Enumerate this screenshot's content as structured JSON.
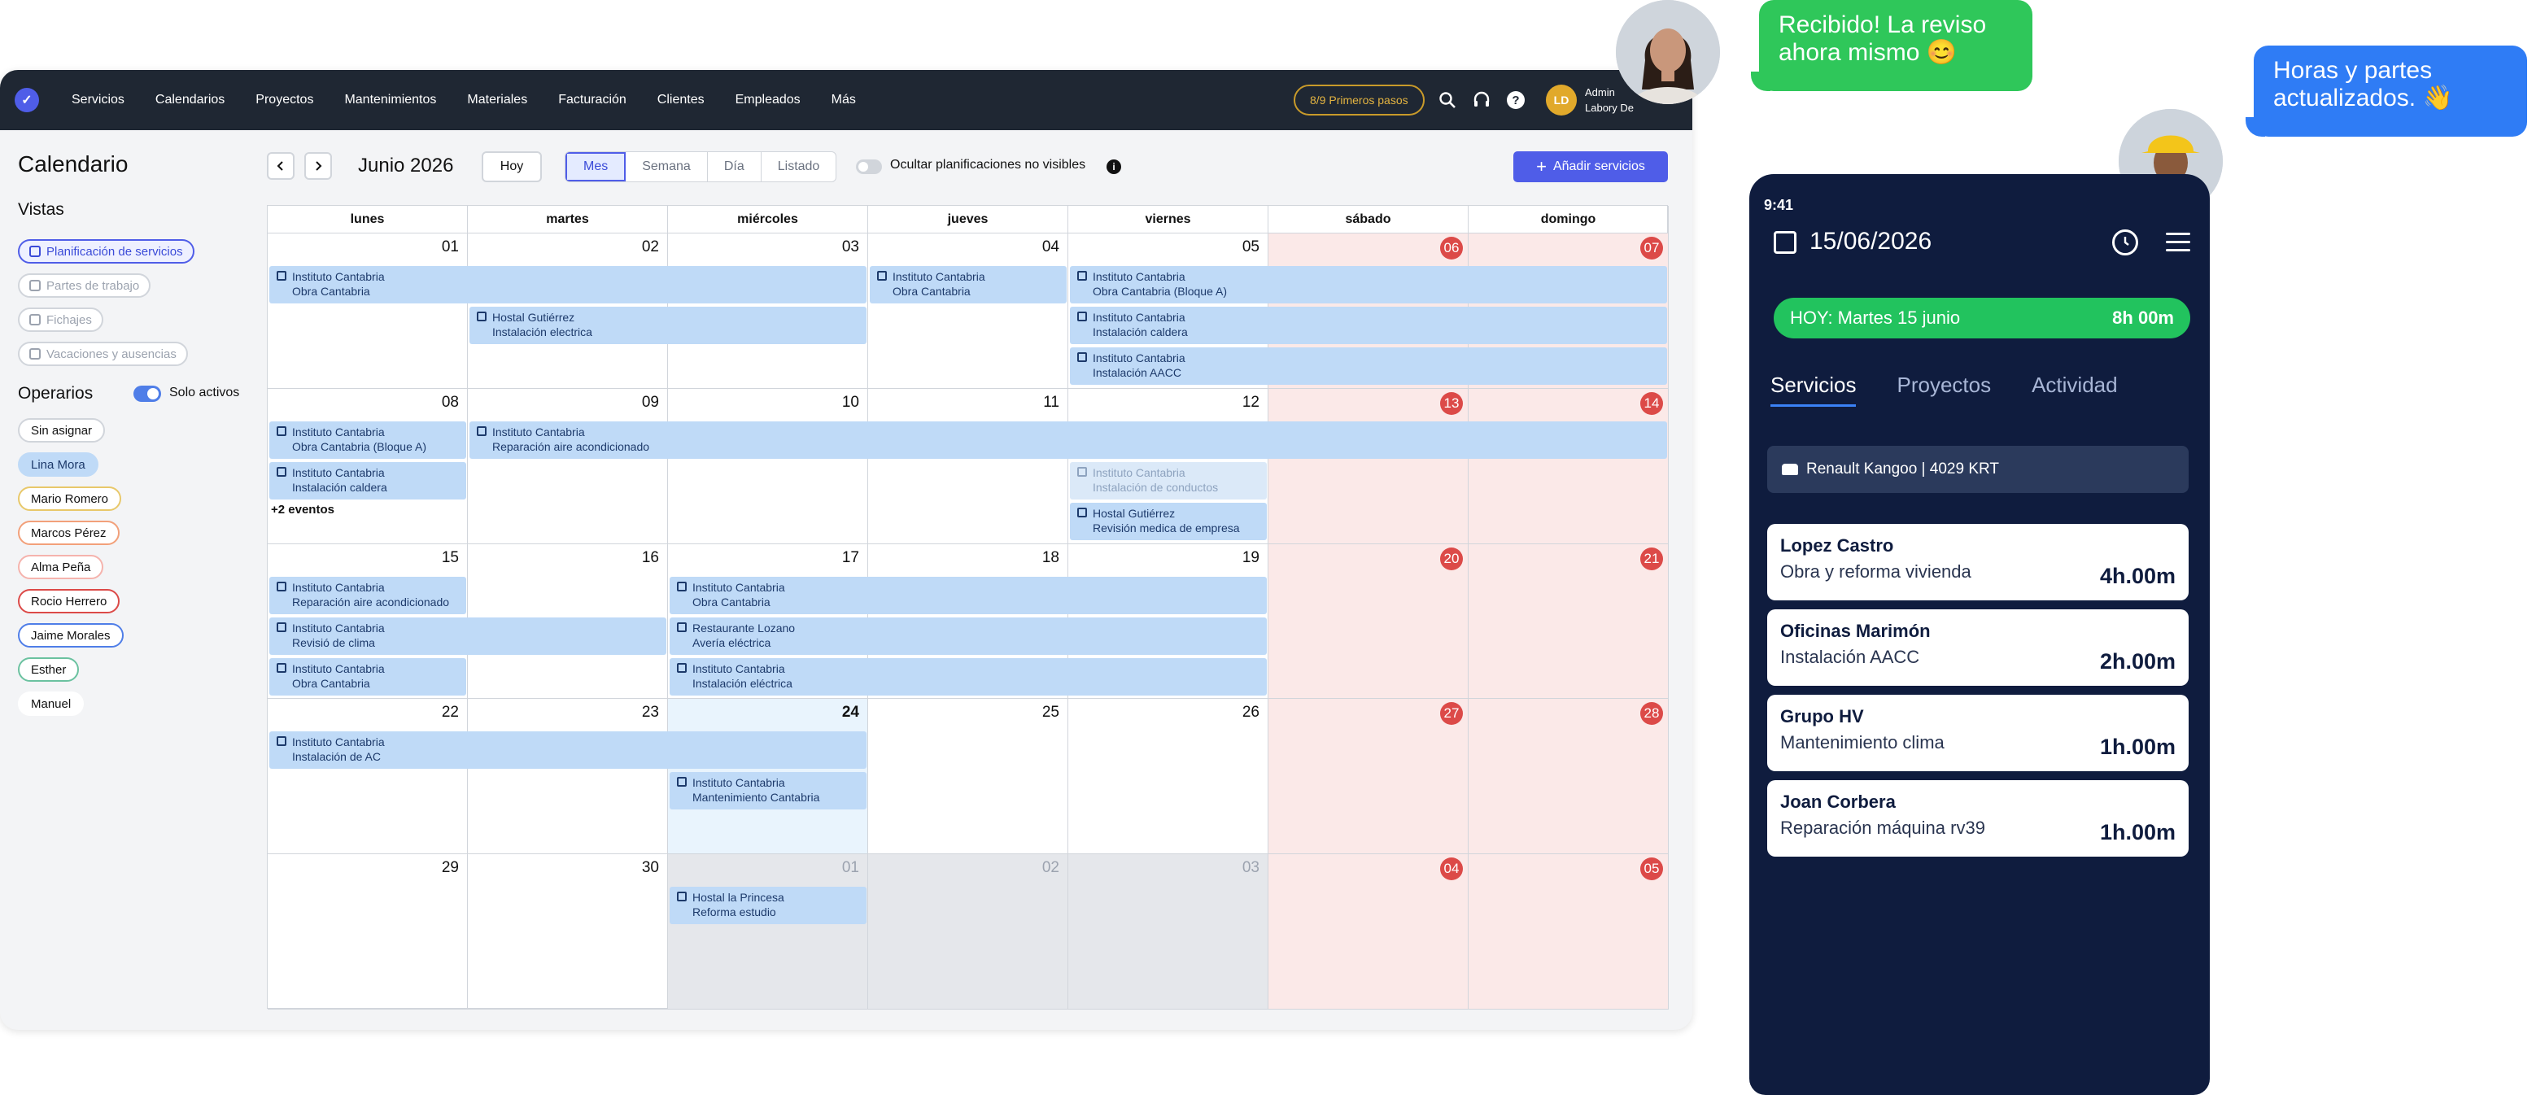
{
  "nav": {
    "items": [
      "Servicios",
      "Calendarios",
      "Proyectos",
      "Mantenimientos",
      "Materiales",
      "Facturación",
      "Clientes",
      "Empleados",
      "Más"
    ],
    "steps_pill": "8/9 Primeros pasos",
    "user_initials": "LD",
    "user_line1": "Admin",
    "user_line2": "Labory De"
  },
  "sidebar": {
    "title": "Calendario",
    "views_title": "Vistas",
    "views": [
      "Planificación de servicios",
      "Partes de trabajo",
      "Fichajes",
      "Vacaciones y ausencias"
    ],
    "operators_title": "Operarios",
    "only_active": "Solo activos",
    "operators": [
      {
        "name": "Sin asignar",
        "color": "#d1d5db",
        "bg": "#ffffff"
      },
      {
        "name": "Lina Mora",
        "color": "#bfdaf7",
        "bg": "#bfdaf7"
      },
      {
        "name": "Mario Romero",
        "color": "#e8c86a",
        "bg": "#ffffff"
      },
      {
        "name": "Marcos Pérez",
        "color": "#f2a07a",
        "bg": "#ffffff"
      },
      {
        "name": "Alma Peña",
        "color": "#f5b3ad",
        "bg": "#ffffff"
      },
      {
        "name": "Rocio Herrero",
        "color": "#dc4a48",
        "bg": "#ffffff"
      },
      {
        "name": "Jaime Morales",
        "color": "#4f7ee8",
        "bg": "#ffffff"
      },
      {
        "name": "Esther",
        "color": "#6bc2a0",
        "bg": "#ffffff"
      },
      {
        "name": "Manuel",
        "color": "#ffffff",
        "bg": "#ffffff"
      }
    ]
  },
  "toolbar": {
    "month": "Junio 2026",
    "today": "Hoy",
    "modes": [
      "Mes",
      "Semana",
      "Día",
      "Listado"
    ],
    "hide_label": "Ocultar planificaciones no visibles",
    "add_label": "Añadir servicios"
  },
  "calendar": {
    "weekdays": [
      "lunes",
      "martes",
      "miércoles",
      "jueves",
      "viernes",
      "sábado",
      "domingo"
    ],
    "weeks": [
      [
        "01",
        "02",
        "03",
        "04",
        "05",
        "06",
        "07"
      ],
      [
        "08",
        "09",
        "10",
        "11",
        "12",
        "13",
        "14"
      ],
      [
        "15",
        "16",
        "17",
        "18",
        "19",
        "20",
        "21"
      ],
      [
        "22",
        "23",
        "24",
        "25",
        "26",
        "27",
        "28"
      ],
      [
        "29",
        "30",
        "01",
        "02",
        "03",
        "04",
        "05"
      ]
    ],
    "today_label": "24",
    "more_label": "+2 eventos",
    "events": [
      {
        "week": 0,
        "start": 0,
        "span": 3,
        "lane": 0,
        "title": "Instituto Cantabria",
        "subtitle": "Obra Cantabria"
      },
      {
        "week": 0,
        "start": 1,
        "span": 2,
        "lane": 1,
        "title": "Hostal Gutiérrez",
        "subtitle": "Instalación electrica"
      },
      {
        "week": 0,
        "start": 3,
        "span": 1,
        "lane": 0,
        "title": "Instituto Cantabria",
        "subtitle": "Obra Cantabria"
      },
      {
        "week": 0,
        "start": 4,
        "span": 3,
        "lane": 0,
        "title": "Instituto Cantabria",
        "subtitle": "Obra Cantabria (Bloque A)"
      },
      {
        "week": 0,
        "start": 4,
        "span": 3,
        "lane": 1,
        "title": "Instituto Cantabria",
        "subtitle": "Instalación caldera"
      },
      {
        "week": 0,
        "start": 4,
        "span": 3,
        "lane": 2,
        "title": "Instituto Cantabria",
        "subtitle": "Instalación AACC"
      },
      {
        "week": 1,
        "start": 0,
        "span": 1,
        "lane": 0,
        "title": "Instituto Cantabria",
        "subtitle": "Obra Cantabria (Bloque A)"
      },
      {
        "week": 1,
        "start": 1,
        "span": 6,
        "lane": 0,
        "title": "Instituto Cantabria",
        "subtitle": "Reparación aire acondicionado"
      },
      {
        "week": 1,
        "start": 0,
        "span": 1,
        "lane": 1,
        "title": "Instituto Cantabria",
        "subtitle": "Instalación caldera"
      },
      {
        "week": 1,
        "start": 4,
        "span": 1,
        "lane": 1,
        "title": "Instituto Cantabria",
        "subtitle": "Instalación de conductos",
        "faded": true
      },
      {
        "week": 1,
        "start": 4,
        "span": 1,
        "lane": 2,
        "title": "Hostal Gutiérrez",
        "subtitle": "Revisión medica de empresa"
      },
      {
        "week": 2,
        "start": 0,
        "span": 1,
        "lane": 0,
        "title": "Instituto Cantabria",
        "subtitle": "Reparación aire acondicionado"
      },
      {
        "week": 2,
        "start": 0,
        "span": 2,
        "lane": 1,
        "title": "Instituto Cantabria",
        "subtitle": "Revisió de clima"
      },
      {
        "week": 2,
        "start": 0,
        "span": 1,
        "lane": 2,
        "title": "Instituto Cantabria",
        "subtitle": "Obra Cantabria"
      },
      {
        "week": 2,
        "start": 2,
        "span": 3,
        "lane": 0,
        "title": "Instituto Cantabria",
        "subtitle": "Obra Cantabria"
      },
      {
        "week": 2,
        "start": 2,
        "span": 3,
        "lane": 1,
        "title": "Restaurante Lozano",
        "subtitle": "Avería eléctrica"
      },
      {
        "week": 2,
        "start": 2,
        "span": 3,
        "lane": 2,
        "title": "Instituto Cantabria",
        "subtitle": "Instalación eléctrica"
      },
      {
        "week": 3,
        "start": 0,
        "span": 3,
        "lane": 0,
        "title": "Instituto Cantabria",
        "subtitle": "Instalación de AC"
      },
      {
        "week": 3,
        "start": 2,
        "span": 1,
        "lane": 1,
        "title": "Instituto Cantabria",
        "subtitle": "Mantenimiento Cantabria"
      },
      {
        "week": 4,
        "start": 2,
        "span": 1,
        "lane": 0,
        "title": "Hostal la Princesa",
        "subtitle": "Reforma estudio"
      }
    ]
  },
  "phone": {
    "time": "9:41",
    "date": "15/06/2026",
    "today_label": "HOY: Martes 15 junio",
    "today_hours": "8h 00m",
    "tabs": [
      "Servicios",
      "Proyectos",
      "Actividad"
    ],
    "vehicle": "Renault Kangoo | 4029 KRT",
    "cards": [
      {
        "title": "Lopez Castro",
        "subtitle": "Obra y reforma vivienda",
        "hours": "4h.00m"
      },
      {
        "title": "Oficinas Marimón",
        "subtitle": "Instalación AACC",
        "hours": "2h.00m"
      },
      {
        "title": "Grupo HV",
        "subtitle": "Mantenimiento clima",
        "hours": "1h.00m"
      },
      {
        "title": "Joan Corbera",
        "subtitle": "Reparación máquina rv39",
        "hours": "1h.00m"
      }
    ]
  },
  "chat": {
    "message_left": "Recibido! La reviso ahora mismo 😊",
    "message_right": "Horas y partes actualizados. 👋"
  }
}
